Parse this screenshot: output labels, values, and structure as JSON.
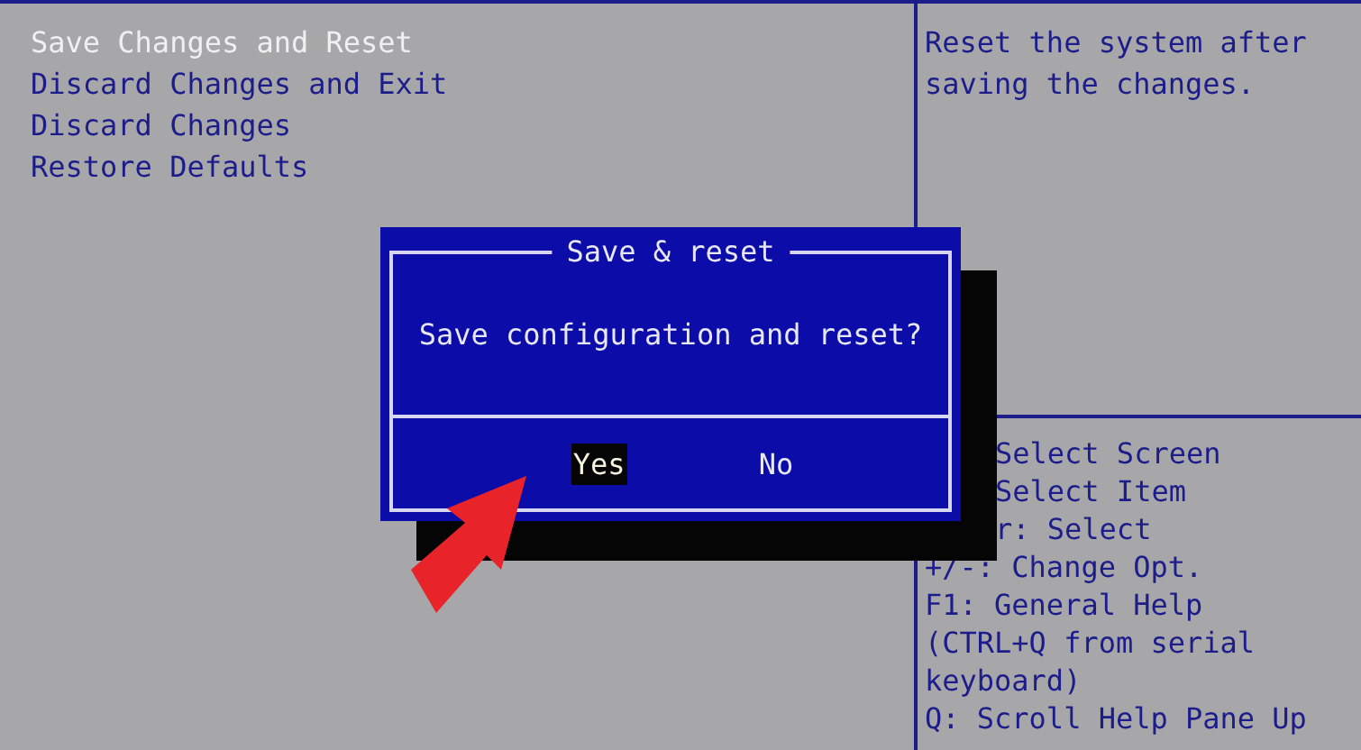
{
  "menu": [
    {
      "label": "Save Changes and Reset",
      "selected": true
    },
    {
      "label": "Discard Changes and Exit",
      "selected": false
    },
    {
      "label": "Discard Changes",
      "selected": false
    },
    {
      "label": "Restore Defaults",
      "selected": false
    }
  ],
  "help_description": [
    "Reset the system after",
    "saving the changes."
  ],
  "key_help": [
    {
      "text": "Select Screen",
      "kind": "clipped"
    },
    {
      "text": "Select Item",
      "kind": "clipped"
    },
    {
      "text": "r: Select",
      "kind": "clipped"
    },
    {
      "text": "+/-: Change Opt.",
      "kind": "full"
    },
    {
      "text": "F1: General Help",
      "kind": "full"
    },
    {
      "text": "(CTRL+Q from serial",
      "kind": "full"
    },
    {
      "text": "keyboard)",
      "kind": "full"
    },
    {
      "text": "Q: Scroll Help Pane Up",
      "kind": "full"
    }
  ],
  "dialog": {
    "title": "Save & reset",
    "message": "Save configuration and reset?",
    "buttons": [
      {
        "label": "Yes",
        "selected": true
      },
      {
        "label": "No",
        "selected": false
      }
    ]
  }
}
